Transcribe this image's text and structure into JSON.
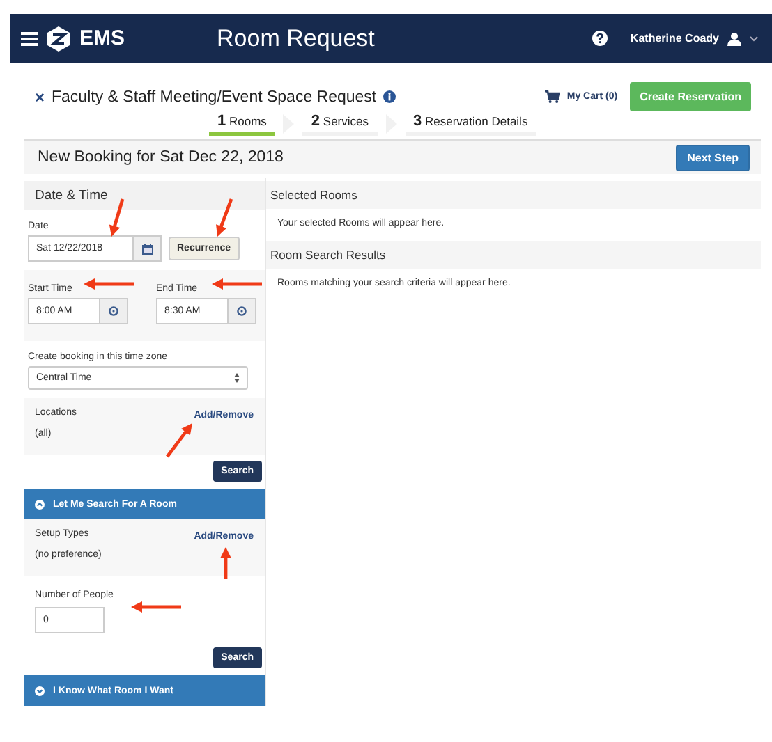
{
  "header": {
    "brand": "EMS",
    "title": "Room Request",
    "user": "Katherine Coady"
  },
  "request": {
    "close": "×",
    "title": "Faculty & Staff Meeting/Event Space Request",
    "cart": "My Cart (0)",
    "create_button": "Create Reservation"
  },
  "steps": [
    {
      "number": "1",
      "label": "Rooms",
      "selected": true
    },
    {
      "number": "2",
      "label": "Services",
      "selected": false
    },
    {
      "number": "3",
      "label": "Reservation Details",
      "selected": false
    }
  ],
  "booking_title": "New Booking for Sat Dec 22, 2018",
  "next_button": "Next Step",
  "date_time": {
    "heading": "Date & Time",
    "date_label": "Date",
    "date_value": "Sat 12/22/2018",
    "recurrence_button": "Recurrence",
    "start_label": "Start Time",
    "start_value": "8:00 AM",
    "end_label": "End Time",
    "end_value": "8:30 AM",
    "timezone_label": "Create booking in this time zone",
    "timezone_value": "Central Time",
    "locations_label": "Locations",
    "locations_link": "Add/Remove",
    "locations_value": "(all)",
    "search_button": "Search"
  },
  "search_section": {
    "heading": "Let Me Search For A Room",
    "expanded": true,
    "setup_label": "Setup Types",
    "setup_link": "Add/Remove",
    "setup_value": "(no preference)",
    "people_label": "Number of People",
    "people_value": "0",
    "search_button": "Search"
  },
  "know_section": {
    "heading": "I Know What Room I Want",
    "expanded": false
  },
  "selected_rooms": {
    "heading": "Selected Rooms",
    "text": "Your selected Rooms will appear here."
  },
  "results": {
    "heading": "Room Search Results",
    "text": "Rooms matching your search criteria will appear here."
  }
}
